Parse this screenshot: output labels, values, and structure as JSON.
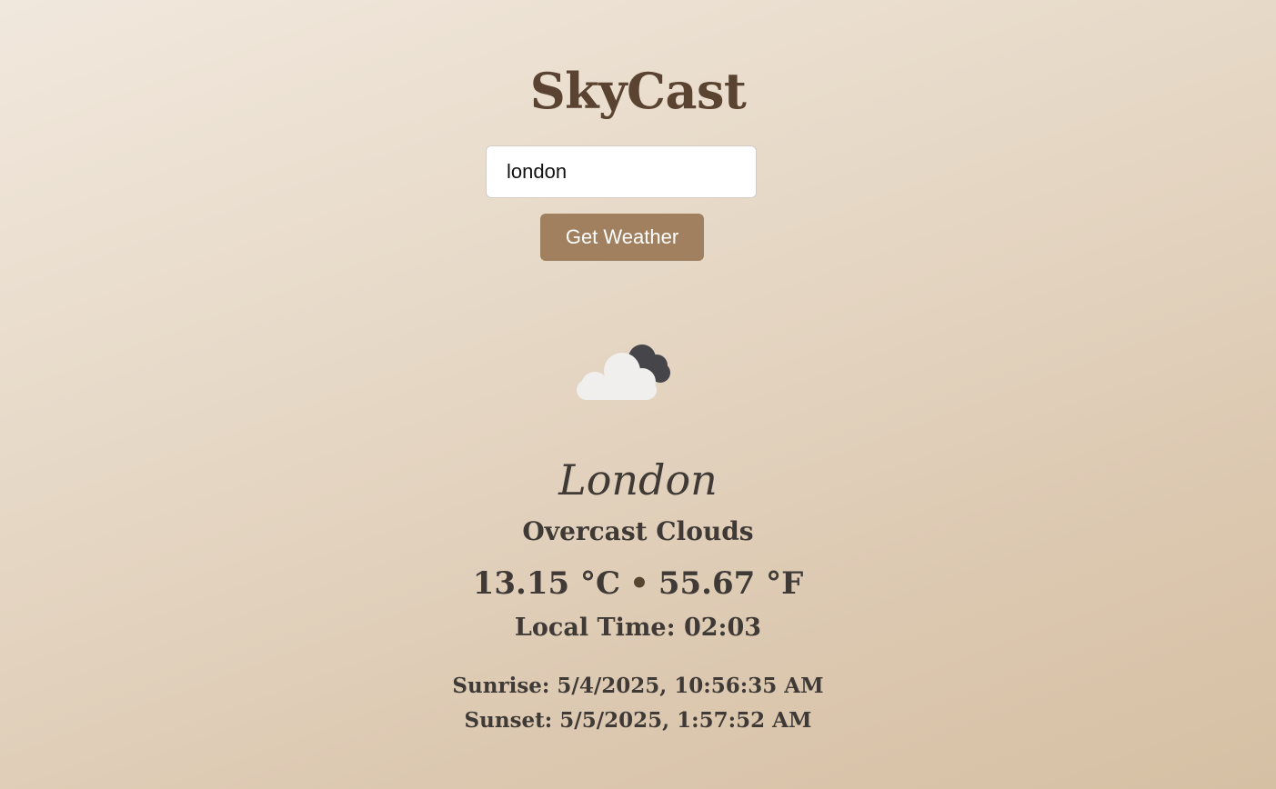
{
  "app": {
    "title": "SkyCast"
  },
  "search": {
    "value": "london",
    "button_label": "Get Weather"
  },
  "weather": {
    "icon": "cloud-icon",
    "city": "London",
    "description": "Overcast Clouds",
    "temp_c": "13.15 °C",
    "separator": "•",
    "temp_f": "55.67 °F",
    "local_time": "Local Time: 02:03",
    "sunrise": "Sunrise: 5/4/2025, 10:56:35 AM",
    "sunset": "Sunset: 5/5/2025, 1:57:52 AM"
  },
  "colors": {
    "accent": "#a0805f",
    "title": "#5a4330",
    "text": "#3f3a36"
  }
}
